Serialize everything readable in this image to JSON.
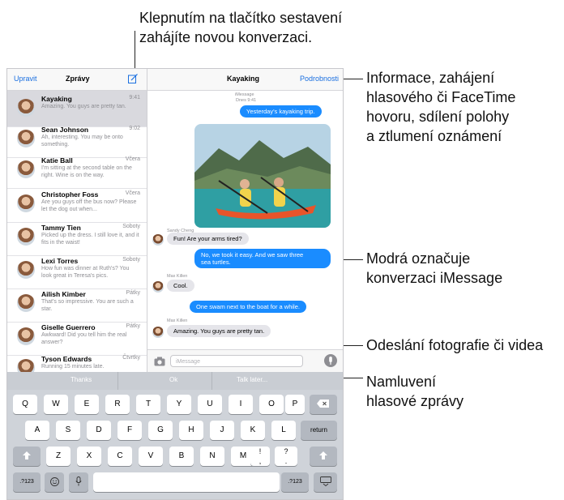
{
  "callouts": {
    "compose": [
      "Klepnutím na tlačítko sestavení",
      "zahájíte novou konverzaci."
    ],
    "details": [
      "Informace, zahájení",
      "hlasového či FaceTime",
      "hovoru, sdílení polohy",
      "a ztlumení oznámení"
    ],
    "blue": [
      "Modrá označuje",
      "konverzaci iMessage"
    ],
    "photo": [
      "Odeslání fotografie či videa"
    ],
    "voice": [
      "Namluvení",
      "hlasové zprávy"
    ]
  },
  "sidebar": {
    "edit": "Upravit",
    "title": "Zprávy",
    "compose_icon": "compose-icon",
    "conversations": [
      {
        "name": "Kayaking",
        "time": "9:41",
        "preview": "Amazing. You guys are pretty tan."
      },
      {
        "name": "Sean Johnson",
        "time": "9:02",
        "preview": "Ah, interesting. You may be onto something."
      },
      {
        "name": "Katie Ball",
        "time": "Včera",
        "preview": "I'm sitting at the second table on the right. Wine is on the way."
      },
      {
        "name": "Christopher Foss",
        "time": "Včera",
        "preview": "Are you guys off the bus now? Please let the dog out when..."
      },
      {
        "name": "Tammy Tien",
        "time": "Soboty",
        "preview": "Picked up the dress. I still love it, and it fits in the waist!"
      },
      {
        "name": "Lexi Torres",
        "time": "Soboty",
        "preview": "How fun was dinner at Ruth's? You look great in Teresa's pics."
      },
      {
        "name": "Ailish Kimber",
        "time": "Pátky",
        "preview": "That's so impressive. You are such a star."
      },
      {
        "name": "Giselle Guerrero",
        "time": "Pátky",
        "preview": "Awkward! Did you tell him the real answer?"
      },
      {
        "name": "Tyson Edwards",
        "time": "Čtvrtky",
        "preview": "Running 15 minutes late."
      }
    ]
  },
  "chat": {
    "title": "Kayaking",
    "details": "Podrobnosti",
    "service": "iMessage",
    "service_time": "Dnes 9:41",
    "messages": {
      "m1": "Yesterday's kayaking trip.",
      "sender1": "Sandy Cheng",
      "m2": "Fun! Are your arms tired?",
      "m3a": "No, we took it easy. And we saw three",
      "m3b": "sea turtles.",
      "sender2": "Max Killen",
      "m4": "Cool.",
      "m5": "One swam next to the boat for a while.",
      "sender3": "Max Killen",
      "m6": "Amazing. You guys are pretty tan."
    },
    "input_placeholder": "iMessage",
    "camera_icon": "camera-icon",
    "mic_icon": "microphone-icon"
  },
  "keyboard": {
    "suggestions": [
      "Thanks",
      "Ok",
      "Talk later..."
    ],
    "row1": [
      "Q",
      "W",
      "E",
      "R",
      "T",
      "Y",
      "U",
      "I",
      "O",
      "P"
    ],
    "row2": [
      "A",
      "S",
      "D",
      "F",
      "G",
      "H",
      "J",
      "K",
      "L"
    ],
    "row3": [
      "Z",
      "X",
      "C",
      "V",
      "B",
      "N",
      "M",
      "!",
      "?"
    ],
    "return": "return",
    "num_left": ".?123",
    "num_right": ".?123",
    "delete_icon": "delete-icon",
    "shift_icon": "shift-icon",
    "emoji_icon": "emoji-icon",
    "dictation_icon": "microphone-icon",
    "hide_keyboard_icon": "keyboard-hide-icon",
    "punct_row3": [
      ",",
      "."
    ]
  }
}
